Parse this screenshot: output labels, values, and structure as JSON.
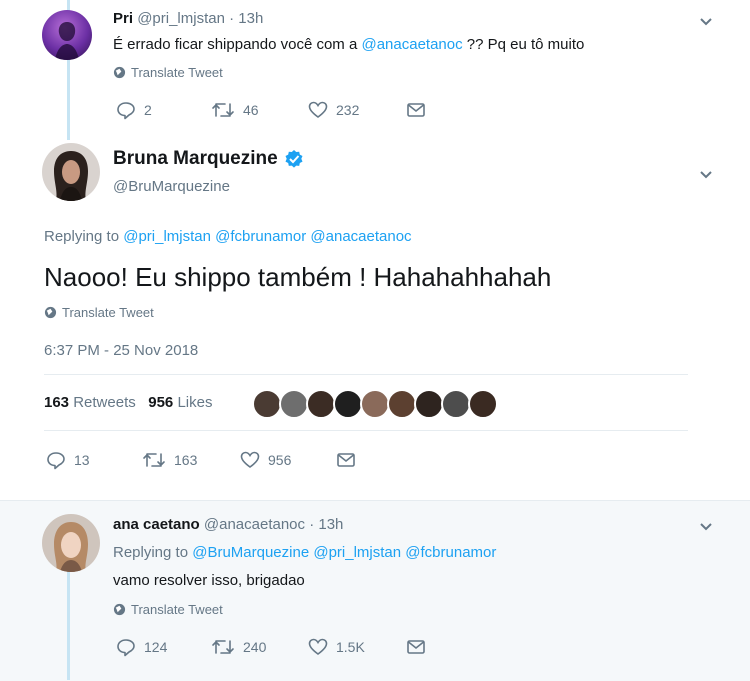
{
  "tweet1": {
    "name": "Pri",
    "handle": "@pri_lmjstan",
    "time": "· 13h",
    "text_prefix": "É errado ficar shippando você com a ",
    "mention": "@anacaetanoc",
    "text_suffix": " ?? Pq eu tô muito",
    "translate": "Translate Tweet",
    "replies": "2",
    "retweets": "46",
    "likes": "232"
  },
  "main": {
    "name": "Bruna Marquezine",
    "handle": "@BruMarquezine",
    "replying_label": "Replying to",
    "replying_to": [
      "@pri_lmjstan",
      "@fcbrunamor",
      "@anacaetanoc"
    ],
    "text": "Naooo! Eu shippo também ! Hahahahhahah",
    "translate": "Translate Tweet",
    "timestamp": "6:37 PM - 25 Nov 2018",
    "retweet_count": "163",
    "retweet_label": "Retweets",
    "like_count": "956",
    "like_label": "Likes",
    "replies": "13",
    "retweets": "163",
    "likes": "956"
  },
  "tweet3": {
    "name": "ana caetano",
    "handle": "@anacaetanoc",
    "time": "· 13h",
    "replying_label": "Replying to",
    "replying_to": [
      "@BruMarquezine",
      "@pri_lmjstan",
      "@fcbrunamor"
    ],
    "text": "vamo resolver isso, brigadao",
    "translate": "Translate Tweet",
    "replies": "124",
    "retweets": "240",
    "likes": "1.5K"
  },
  "colors": {
    "link": "#1da1f2",
    "verified": "#1da1f2",
    "thread_line": "#c6e4f3",
    "highlight_bg": "#f5f8fa"
  },
  "icons": [
    "reply-icon",
    "retweet-icon",
    "like-icon",
    "message-icon",
    "globe-icon",
    "chevron-down-icon",
    "verified-badge-icon"
  ]
}
